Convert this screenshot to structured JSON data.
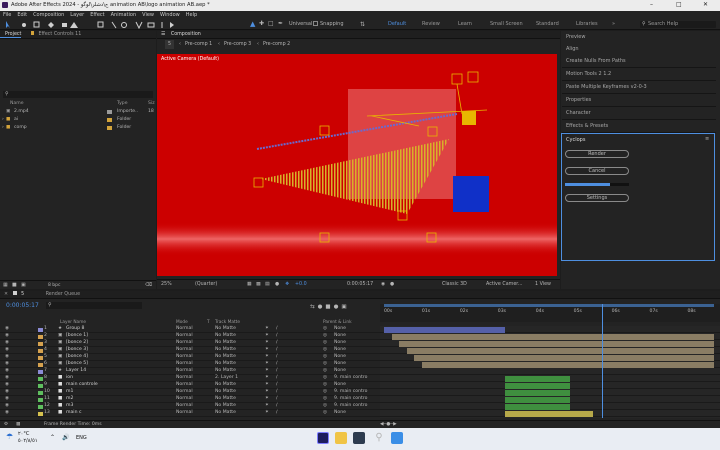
{
  "titlebar": {
    "title": "Adobe After Effects 2024 - ج\\دشلر\\لوگو animation AB\\logo animation AB.aep *"
  },
  "menu": [
    "File",
    "Edit",
    "Composition",
    "Layer",
    "Effect",
    "Animation",
    "View",
    "Window",
    "Help"
  ],
  "toolbar": {
    "universal": "Universal",
    "snapping": "Snapping",
    "workspaces": [
      "Default",
      "Review",
      "Learn",
      "Small Screen",
      "Standard",
      "Libraries"
    ],
    "search_placeholder": "Search Help"
  },
  "project_panel": {
    "tabs": [
      "Project",
      "Effect Controls 11"
    ],
    "search_placeholder": "",
    "columns": [
      "Name",
      "Type",
      "Siz"
    ],
    "items": [
      {
        "name": "2.mp4",
        "type": "Importe..",
        "size": "18",
        "color": "#9a9a9a"
      },
      {
        "name": "ai",
        "type": "Folder",
        "size": "",
        "color": "#d3a43b"
      },
      {
        "name": "comp",
        "type": "Folder",
        "size": "",
        "color": "#d3a43b"
      }
    ],
    "bpc": "8 bpc"
  },
  "composition": {
    "tab": "Composition",
    "breadcrumbs": [
      "5",
      "Pre-comp 1",
      "Pre-comp 3",
      "Pre-comp 2"
    ],
    "view_label": "Active Camera (Default)",
    "bg_color": "#cc0000",
    "footer": {
      "zoom": "25%",
      "quality": "(Quarter)",
      "exposure": "+0.0",
      "timecode": "0:00:05:17",
      "renderer": "Classic 3D",
      "camera": "Active Camer...",
      "views": "1 View"
    }
  },
  "right_panels": [
    "Preview",
    "Align",
    "Create Nulls From Paths",
    "Motion Tools 2 1.2",
    "Paste Multiple Keyframes v2-0-3",
    "Properties",
    "Character",
    "Effects & Presets"
  ],
  "cyclops": {
    "title": "Cyclops",
    "buttons": [
      "Render",
      "Cancel",
      "Settings"
    ],
    "progress": 0.7
  },
  "timeline": {
    "tabs": [
      "5",
      "Render Queue"
    ],
    "timecode": "0:00:05:17",
    "columns": {
      "layer_name": "Layer Name",
      "mode": "Mode",
      "t": "T",
      "track_matte": "Track Matte",
      "parent": "Parent & Link"
    },
    "ruler": [
      "00s",
      "01s",
      "02s",
      "03s",
      "04s",
      "05s",
      "06s",
      "07s",
      "08s"
    ],
    "playhead_time": 5.75,
    "duration": 8.7,
    "layers": [
      {
        "num": "1",
        "name": "Group 8",
        "label": "#8c8cd6",
        "icon": "star-icon",
        "mode": "Normal",
        "matte": "No Matte",
        "parent": "None",
        "start": 0,
        "end": 3.2,
        "bar": "#5560a8",
        "has_parent_link": false
      },
      {
        "num": "2",
        "name": "[bonce 1]",
        "label": "#d6a24f",
        "icon": "comp-icon",
        "mode": "Normal",
        "matte": "No Matte",
        "parent": "None",
        "start": 0.2,
        "end": 8.7,
        "bar": "#8a7d64",
        "has_parent_link": false
      },
      {
        "num": "3",
        "name": "[bonce 2]",
        "label": "#d6a24f",
        "icon": "comp-icon",
        "mode": "Normal",
        "matte": "No Matte",
        "parent": "None",
        "start": 0.4,
        "end": 8.7,
        "bar": "#8a7d64",
        "has_parent_link": false
      },
      {
        "num": "4",
        "name": "[bonce 3]",
        "label": "#d6a24f",
        "icon": "comp-icon",
        "mode": "Normal",
        "matte": "No Matte",
        "parent": "None",
        "start": 0.6,
        "end": 8.7,
        "bar": "#8a7d64",
        "has_parent_link": false
      },
      {
        "num": "5",
        "name": "[bonce 4]",
        "label": "#d6a24f",
        "icon": "comp-icon",
        "mode": "Normal",
        "matte": "No Matte",
        "parent": "None",
        "start": 0.8,
        "end": 8.7,
        "bar": "#8a7d64",
        "has_parent_link": false
      },
      {
        "num": "6",
        "name": "[bonce 5]",
        "label": "#d6a24f",
        "icon": "comp-icon",
        "mode": "Normal",
        "matte": "No Matte",
        "parent": "None",
        "start": 1.0,
        "end": 8.7,
        "bar": "#8a7d64",
        "has_parent_link": false
      },
      {
        "num": "7",
        "name": "Layer 14",
        "label": "#8c8cd6",
        "icon": "star-icon",
        "mode": "Normal",
        "matte": "No Matte",
        "parent": "None",
        "start": 0,
        "end": 0,
        "bar": "#5560a8",
        "has_parent_link": false
      },
      {
        "num": "8",
        "name": "ion",
        "label": "#5fbf5f",
        "icon": "solid-icon",
        "mode": "Normal",
        "matte": "2. Layer 1",
        "parent": "9. main contro",
        "start": 3.2,
        "end": 4.9,
        "bar": "#3f8f3f",
        "has_parent_link": true
      },
      {
        "num": "9",
        "name": "main controle",
        "label": "#5fbf5f",
        "icon": "solid-icon",
        "mode": "Normal",
        "matte": "No Matte",
        "parent": "None",
        "start": 3.2,
        "end": 4.9,
        "bar": "#3f8f3f",
        "has_parent_link": false
      },
      {
        "num": "10",
        "name": "m1",
        "label": "#5fbf5f",
        "icon": "solid-icon",
        "mode": "Normal",
        "matte": "No Matte",
        "parent": "9. main contro",
        "start": 3.2,
        "end": 4.9,
        "bar": "#3f8f3f",
        "has_parent_link": true
      },
      {
        "num": "11",
        "name": "m2",
        "label": "#5fbf5f",
        "icon": "solid-icon",
        "mode": "Normal",
        "matte": "No Matte",
        "parent": "9. main contro",
        "start": 3.2,
        "end": 4.9,
        "bar": "#3f8f3f",
        "has_parent_link": true
      },
      {
        "num": "12",
        "name": "m3",
        "label": "#5fbf5f",
        "icon": "solid-icon",
        "mode": "Normal",
        "matte": "No Matte",
        "parent": "9. main contro",
        "start": 3.2,
        "end": 4.9,
        "bar": "#3f8f3f",
        "has_parent_link": true
      },
      {
        "num": "13",
        "name": "main c",
        "label": "#d6c24f",
        "icon": "solid-icon",
        "mode": "Normal",
        "matte": "No Matte",
        "parent": "None",
        "start": 3.2,
        "end": 5.5,
        "bar": "#b7a94a",
        "has_parent_link": false
      }
    ],
    "footer": "Frame Render Time: 0ms"
  },
  "taskbar": {
    "weather_line1": "۲۰°C",
    "weather_line2": "٥٠۲/۸/٥۱",
    "lang": "ENG"
  }
}
